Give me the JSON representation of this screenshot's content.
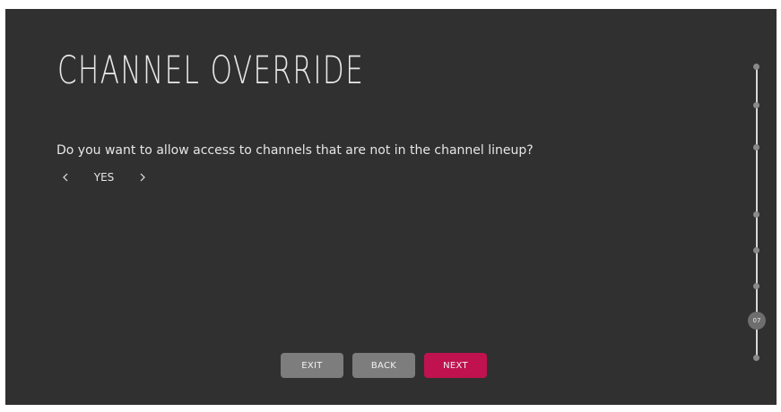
{
  "page": {
    "title": "CHANNEL OVERRIDE",
    "question": "Do you want to allow access to channels that are not in the channel lineup?"
  },
  "selector": {
    "value": "YES",
    "prev_icon": "chevron-left-icon",
    "next_icon": "chevron-right-icon"
  },
  "buttons": {
    "exit_label": "EXIT",
    "back_label": "BACK",
    "next_label": "NEXT"
  },
  "progress": {
    "current_step": "07"
  },
  "colors": {
    "background": "#303030",
    "text": "#e6e6e6",
    "button_gray": "#7d7d7d",
    "accent": "#c0124e"
  }
}
